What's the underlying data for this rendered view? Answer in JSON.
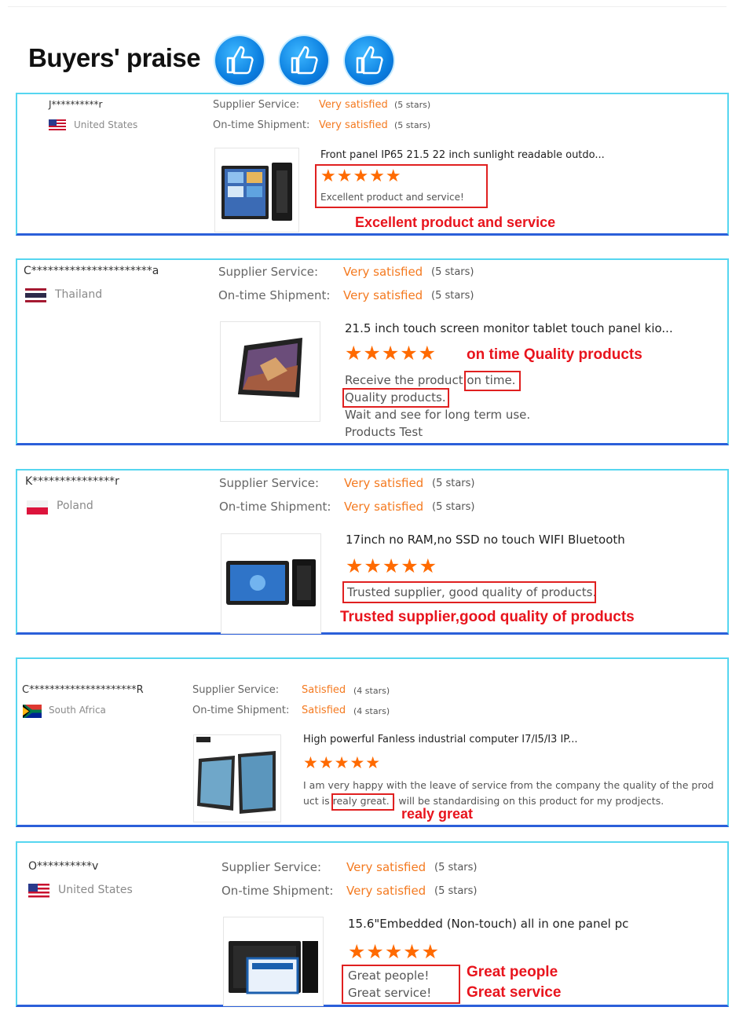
{
  "header": {
    "title": "Buyers' praise",
    "icons": [
      "thumbs-up-icon",
      "thumbs-up-icon",
      "thumbs-up-icon"
    ]
  },
  "labels": {
    "supplier_service": "Supplier Service:",
    "on_time_shipment": "On-time Shipment:"
  },
  "colors": {
    "accent_orange": "#f47a20",
    "annotation_red": "#e8141d",
    "card_border_cyan": "#56d6f0",
    "card_border_blue": "#2b5fd9"
  },
  "reviews": [
    {
      "buyer": "J**********r",
      "country": "United States",
      "supplier_service": "Very satisfied",
      "supplier_stars": "(5 stars)",
      "shipment": "Very satisfied",
      "shipment_stars": "(5 stars)",
      "product_title": "Front panel IP65 21.5 22 inch sunlight readable outdo...",
      "rating": "★★★★★",
      "comment_lines": [
        "Excellent product and service!"
      ],
      "annotations": [
        "Excellent product and service"
      ]
    },
    {
      "buyer": "C**********************a",
      "country": "Thailand",
      "supplier_service": "Very satisfied",
      "supplier_stars": "(5 stars)",
      "shipment": "Very satisfied",
      "shipment_stars": "(5 stars)",
      "product_title": "21.5 inch touch screen monitor tablet touch panel kio...",
      "rating": "★★★★★",
      "comment_lines": [
        "Receive the product on time.",
        "Quality products.",
        "Wait and see for long term use.",
        "Products Test"
      ],
      "annotations": [
        "on time Quality products"
      ]
    },
    {
      "buyer": "K***************r",
      "country": "Poland",
      "supplier_service": "Very satisfied",
      "supplier_stars": "(5 stars)",
      "shipment": "Very satisfied",
      "shipment_stars": "(5 stars)",
      "product_title": "17inch no RAM,no SSD no touch WIFI Bluetooth",
      "rating": "★★★★★",
      "comment_lines": [
        "Trusted supplier, good quality of products."
      ],
      "annotations": [
        "Trusted supplier,good quality of products"
      ]
    },
    {
      "buyer": "C*********************R",
      "country": "South Africa",
      "supplier_service": "Satisfied",
      "supplier_stars": "(4 stars)",
      "shipment": "Satisfied",
      "shipment_stars": "(4 stars)",
      "product_title": "High powerful Fanless industrial computer I7/I5/I3 IP...",
      "rating": "★★★★★",
      "comment_lines": [
        "I am very happy with the leave of service from the company the quality of the prod",
        "uct is realy great. I will be standardising on this product for my prodjects."
      ],
      "annotations": [
        "realy great"
      ]
    },
    {
      "buyer": "O**********v",
      "country": "United States",
      "supplier_service": "Very satisfied",
      "supplier_stars": "(5 stars)",
      "shipment": "Very satisfied",
      "shipment_stars": "(5 stars)",
      "product_title": "15.6\"Embedded (Non-touch) all in one panel pc",
      "rating": "★★★★★",
      "comment_lines": [
        "Great people!",
        "Great service!"
      ],
      "annotations": [
        "Great people",
        "Great service"
      ]
    }
  ]
}
